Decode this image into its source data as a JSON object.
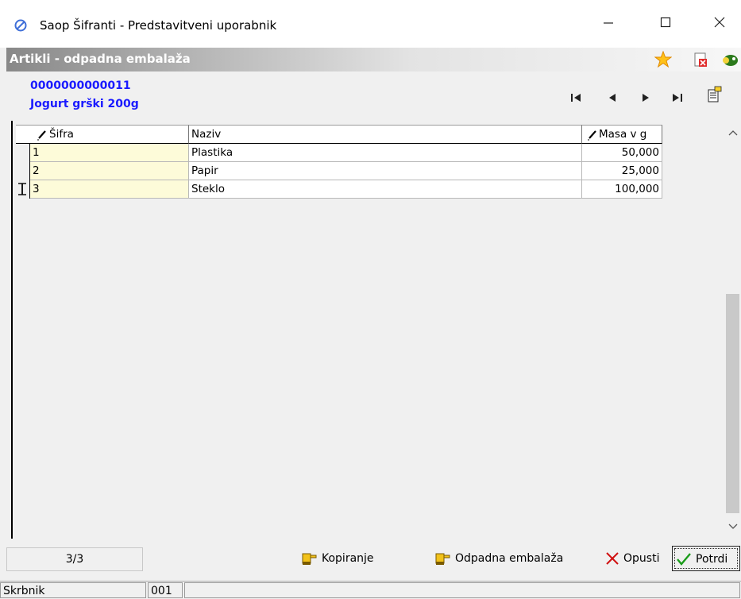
{
  "window": {
    "title": "Saop Šifranti - Predstavitveni uporabnik",
    "controls": {
      "minimize": "—",
      "maximize": "☐",
      "close": "✕"
    }
  },
  "module": {
    "title": "Artikli - odpadna embalaža",
    "icons": [
      "favorite-star-icon",
      "close-document-icon",
      "exit-icon"
    ]
  },
  "record": {
    "code": "0000000000011",
    "name": "Jogurt grški 200g",
    "nav": [
      "first-record-icon",
      "previous-record-icon",
      "next-record-icon",
      "last-record-icon",
      "edit-record-icon"
    ]
  },
  "grid": {
    "columns": {
      "code": "Šifra",
      "name": "Naziv",
      "mass": "Masa v g"
    },
    "rows": [
      {
        "code": "1",
        "name": "Plastika",
        "mass": "50,000"
      },
      {
        "code": "2",
        "name": "Papir",
        "mass": "25,000"
      },
      {
        "code": "3",
        "name": "Steklo",
        "mass": "100,000"
      }
    ]
  },
  "footer": {
    "pager": "3/3",
    "buttons": {
      "copy": "Kopiranje",
      "waste": "Odpadna embalaža",
      "cancel": "Opusti",
      "confirm": "Potrdi"
    }
  },
  "status": {
    "user": "Skrbnik",
    "company": "001",
    "message": ""
  },
  "colors": {
    "link_blue": "#1a1aff",
    "code_cell": "#fdfbd9",
    "cancel_red": "#d01010",
    "confirm_green": "#1a9c1a"
  }
}
